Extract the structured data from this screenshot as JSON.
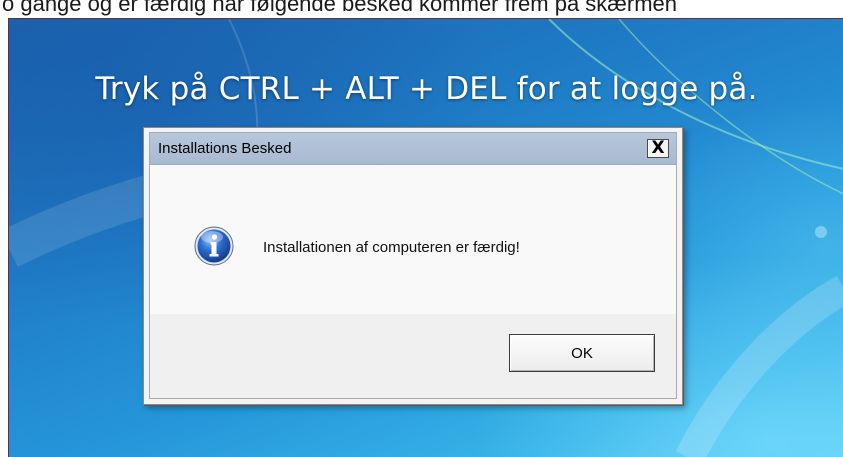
{
  "page": {
    "top_caption": "o gange og er færdig når følgende besked kommer frem på skærmen"
  },
  "logon_screen": {
    "prompt": "Tryk på CTRL + ALT + DEL for at logge på."
  },
  "dialog": {
    "title": "Installations Besked",
    "close_label": "X",
    "message": "Installationen af computeren er færdig!",
    "ok_label": "OK",
    "icon": "info-icon"
  },
  "colors": {
    "desktop_blue": "#1f7cc6",
    "titlebar": "#b7c7dc",
    "dialog_bg": "#f0f0f0",
    "icon_blue": "#1c4fa8"
  }
}
